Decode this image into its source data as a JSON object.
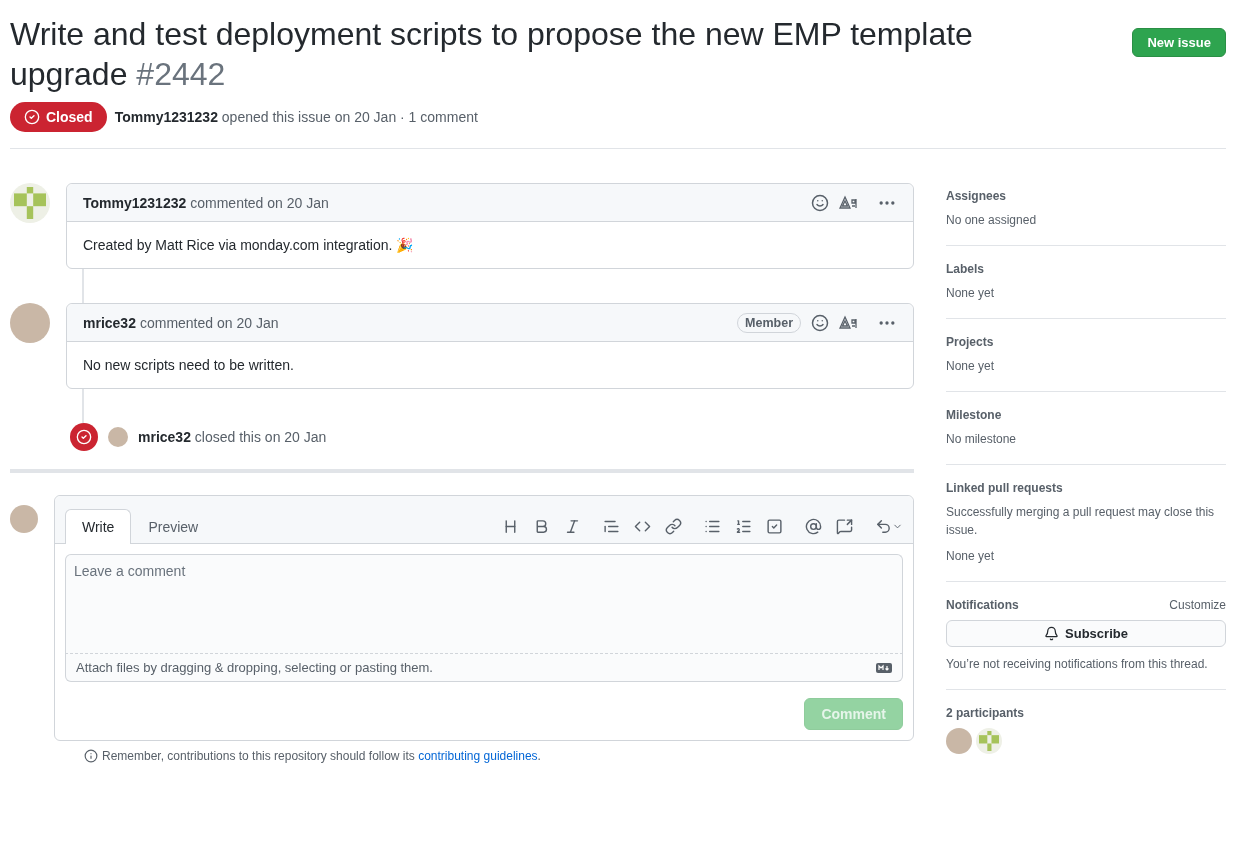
{
  "header": {
    "title": "Write and test deployment scripts to propose the new EMP template upgrade",
    "number": "#2442",
    "new_issue_button": "New issue",
    "state": {
      "label": "Closed",
      "kind": "closed"
    },
    "author": "Tommy1231232",
    "meta": "opened this issue on 20 Jan · 1 comment"
  },
  "timeline": [
    {
      "kind": "comment",
      "author": "Tommy1231232",
      "action": "commented on 20 Jan",
      "avatar": {
        "kind": "identicon"
      },
      "body": "Created by Matt Rice via monday.com integration. 🎉"
    },
    {
      "kind": "comment",
      "author": "mrice32",
      "action": "commented on 20 Jan",
      "badge": "Member",
      "avatar": {
        "kind": "photo"
      },
      "body": "No new scripts need to be written."
    },
    {
      "kind": "event",
      "author": "mrice32",
      "action": "closed this on 20 Jan",
      "avatar": {
        "kind": "photo"
      }
    }
  ],
  "editor": {
    "tabs": [
      {
        "label": "Write",
        "selected": true
      },
      {
        "label": "Preview",
        "selected": false
      }
    ],
    "placeholder": "Leave a comment",
    "attach_hint": "Attach files by dragging & dropping, selecting or pasting them.",
    "submit": {
      "label": "Comment",
      "disabled": true
    }
  },
  "notice": {
    "text": "Remember, contributions to this repository should follow its",
    "link": "contributing guidelines",
    "end": "."
  },
  "sidebar": {
    "sections": [
      {
        "heading": "Assignees",
        "value": "No one assigned"
      },
      {
        "heading": "Labels",
        "value": "None yet"
      },
      {
        "heading": "Projects",
        "value": "None yet"
      },
      {
        "heading": "Milestone",
        "value": "No milestone"
      },
      {
        "heading": "Linked pull requests",
        "note": "Successfully merging a pull request may close this issue.",
        "value": "None yet"
      }
    ],
    "notifications": {
      "heading": "Notifications",
      "customize": "Customize",
      "button": "Subscribe",
      "note": "You’re not receiving notifications from this thread."
    },
    "participants": {
      "heading": "2 participants",
      "avatars": [
        {
          "kind": "photo"
        },
        {
          "kind": "identicon"
        }
      ]
    }
  }
}
